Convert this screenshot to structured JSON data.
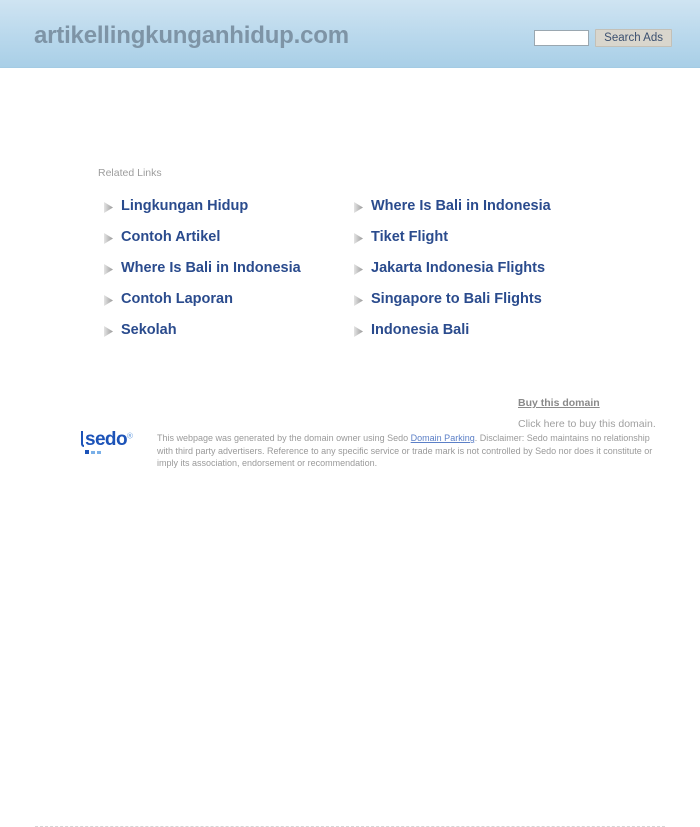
{
  "header": {
    "domain_title": "artikellingkunganhidup.com",
    "search_placeholder": "",
    "search_value": "",
    "search_button_label": "Search Ads",
    "background_color": "#b9d8ec",
    "title_color": "#7e94a6"
  },
  "main": {
    "related_links_label": "Related Links",
    "link_color": "#2a4b8d",
    "bullet_icon": "triangle-right-icon",
    "columns": [
      {
        "items": [
          {
            "label": "Lingkungan Hidup"
          },
          {
            "label": "Contoh Artikel"
          },
          {
            "label": "Where Is Bali in Indonesia"
          },
          {
            "label": "Contoh Laporan"
          },
          {
            "label": "Sekolah"
          }
        ]
      },
      {
        "items": [
          {
            "label": "Where Is Bali in Indonesia"
          },
          {
            "label": "Tiket Flight"
          },
          {
            "label": "Jakarta Indonesia Flights"
          },
          {
            "label": "Singapore to Bali Flights"
          },
          {
            "label": "Indonesia Bali"
          }
        ]
      }
    ]
  },
  "buy_domain": {
    "title": "Buy this domain",
    "subtitle": "Click here to buy this domain."
  },
  "footer": {
    "logo_text": "sedo",
    "logo_registered": "®",
    "disclaimer_part1": "This webpage was generated by the domain owner using Sedo ",
    "disclaimer_link": "Domain Parking",
    "disclaimer_part2": ". Disclaimer: Sedo maintains no relationship with third party advertisers. Reference to any specific service or trade mark is not controlled by Sedo nor does it constitute or imply its association, endorsement or recommendation."
  }
}
